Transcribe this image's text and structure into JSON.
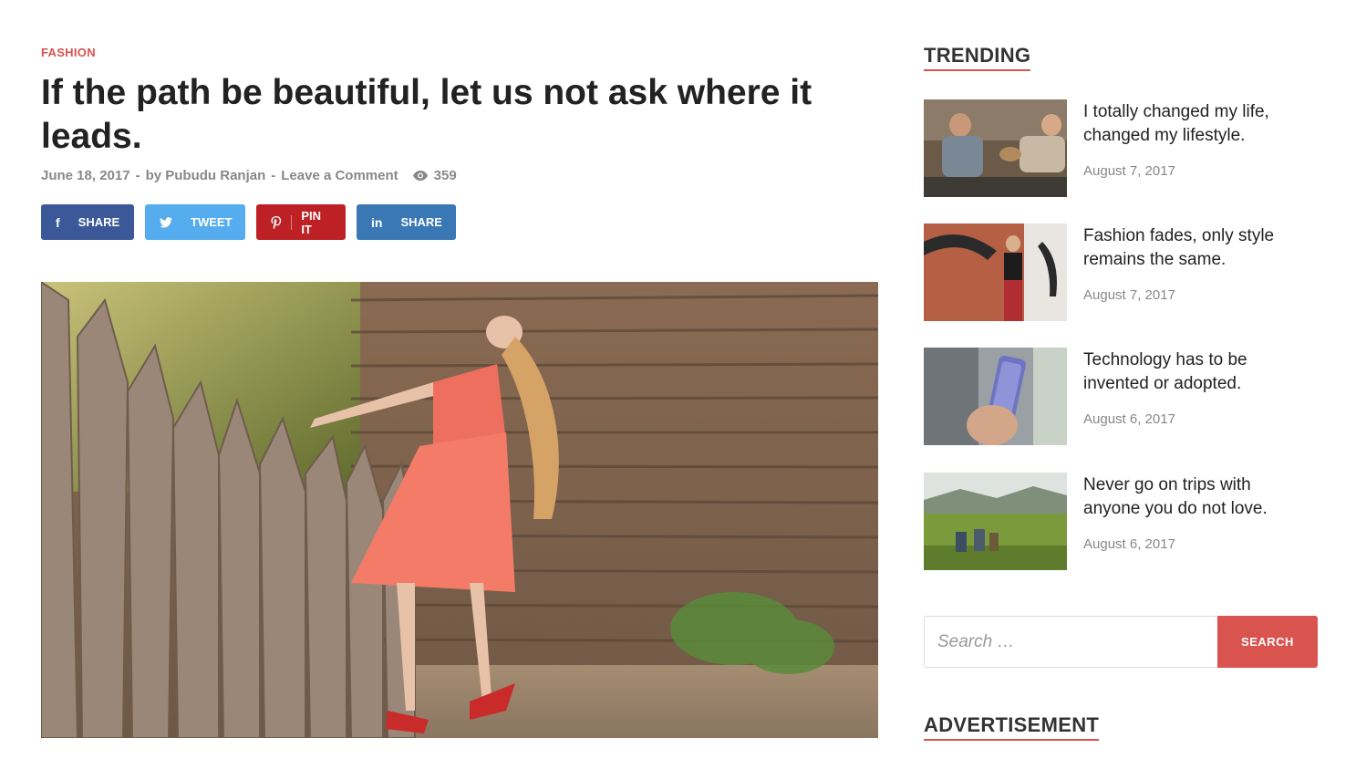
{
  "article": {
    "category": "FASHION",
    "title": "If the path be beautiful, let us not ask where it leads.",
    "date": "June 18, 2017",
    "author": "by Pubudu Ranjan",
    "comment_link": "Leave a Comment",
    "separator": "-",
    "views": "359",
    "image_alt": "Woman in red dress leaning back against wooden fence"
  },
  "share": {
    "facebook": "SHARE",
    "twitter": "TWEET",
    "pinterest": "PIN IT",
    "linkedin": "SHARE"
  },
  "sidebar": {
    "trending_title": "TRENDING",
    "trending": [
      {
        "title": "I totally changed my life, changed my lifestyle.",
        "date": "August 7, 2017"
      },
      {
        "title": "Fashion fades, only style remains the same.",
        "date": "August 7, 2017"
      },
      {
        "title": "Technology has to be invented or adopted.",
        "date": "August 6, 2017"
      },
      {
        "title": "Never go on trips with anyone you do not love.",
        "date": "August 6, 2017"
      }
    ],
    "search": {
      "placeholder": "Search …",
      "button": "SEARCH"
    },
    "advertisement_title": "ADVERTISEMENT"
  },
  "colors": {
    "accent": "#d9534f",
    "facebook": "#3b5998",
    "twitter": "#55acee",
    "pinterest": "#bd2126",
    "linkedin": "#3a78b5"
  }
}
